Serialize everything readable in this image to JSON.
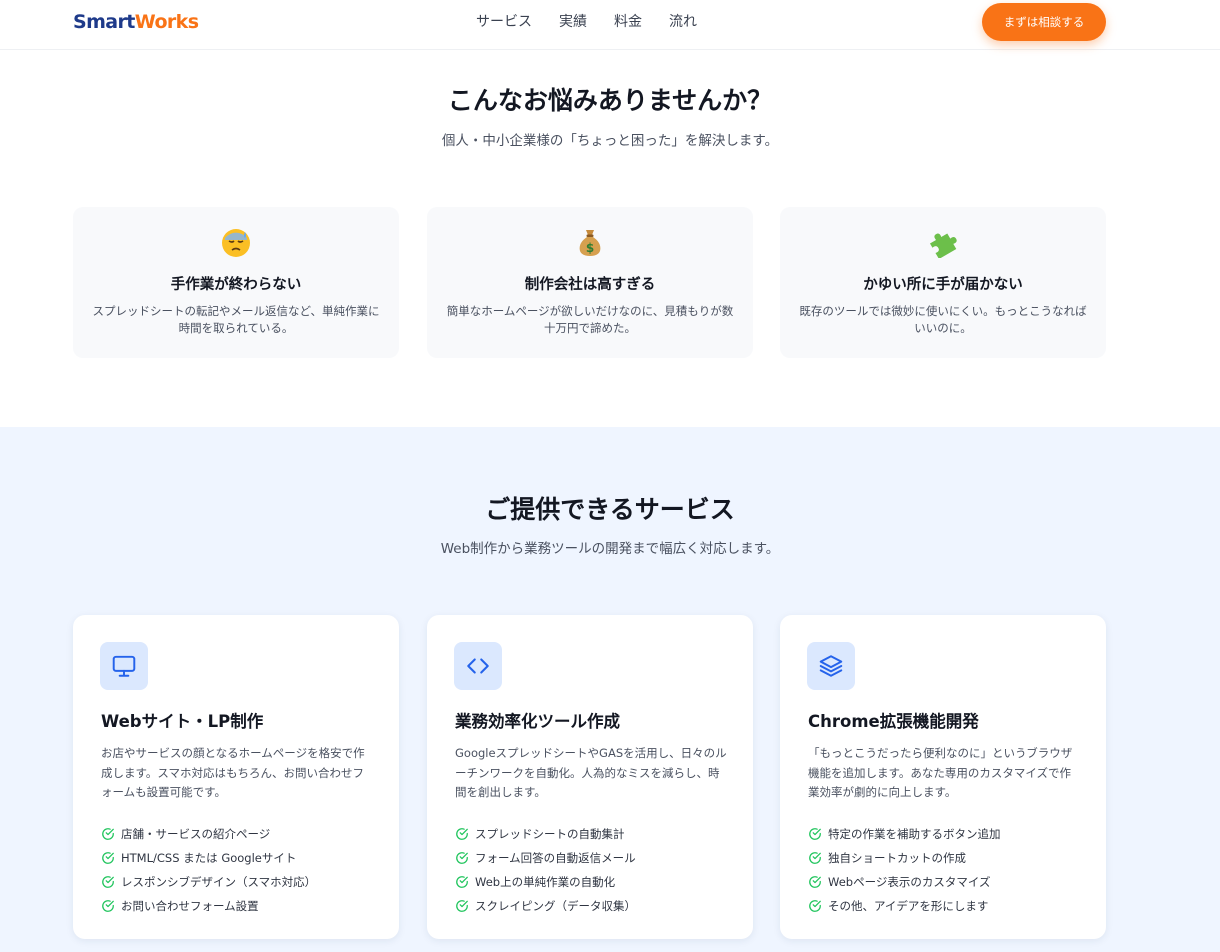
{
  "header": {
    "logo_part1": "Smart",
    "logo_part2": "Works",
    "nav": [
      "サービス",
      "実績",
      "料金",
      "流れ"
    ],
    "cta_label": "まずは相談する"
  },
  "problems": {
    "title": "こんなお悩みありませんか？",
    "subtitle": "個人・中小企業様の「ちょっと困った」を解決します。",
    "cards": [
      {
        "icon": "downcast-sweat-face-icon",
        "title": "手作業が終わらない",
        "text": "スプレッドシートの転記やメール返信など、単純作業に時間を取られている。"
      },
      {
        "icon": "money-bag-icon",
        "title": "制作会社は高すぎる",
        "text": "簡単なホームページが欲しいだけなのに、見積もりが数十万円で諦めた。"
      },
      {
        "icon": "puzzle-piece-icon",
        "title": "かゆい所に手が届かない",
        "text": "既存のツールでは微妙に使いにくい。もっとこうなればいいのに。"
      }
    ]
  },
  "services": {
    "title": "ご提供できるサービス",
    "subtitle": "Web制作から業務ツールの開発まで幅広く対応します。",
    "cards": [
      {
        "icon": "monitor-icon",
        "title": "Webサイト・LP制作",
        "desc": "お店やサービスの顔となるホームページを格安で作成します。スマホ対応はもちろん、お問い合わせフォームも設置可能です。",
        "features": [
          "店舗・サービスの紹介ページ",
          "HTML/CSS または Googleサイト",
          "レスポンシブデザイン（スマホ対応）",
          "お問い合わせフォーム設置"
        ]
      },
      {
        "icon": "code-icon",
        "title": "業務効率化ツール作成",
        "desc": "GoogleスプレッドシートやGASを活用し、日々のルーチンワークを自動化。人為的なミスを減らし、時間を創出します。",
        "features": [
          "スプレッドシートの自動集計",
          "フォーム回答の自動返信メール",
          "Web上の単純作業の自動化",
          "スクレイピング（データ収集）"
        ]
      },
      {
        "icon": "layers-icon",
        "title": "Chrome拡張機能開発",
        "desc": "「もっとこうだったら便利なのに」というブラウザ機能を追加します。あなた専用のカスタマイズで作業効率が劇的に向上します。",
        "features": [
          "特定の作業を補助するボタン追加",
          "独自ショートカットの作成",
          "Webページ表示のカスタマイズ",
          "その他、アイデアを形にします"
        ]
      }
    ]
  },
  "colors": {
    "accent": "#f97316",
    "brand": "#1e3a8a",
    "icon_blue": "#2563eb",
    "check_green": "#22c55e",
    "services_bg": "#eff5ff"
  }
}
